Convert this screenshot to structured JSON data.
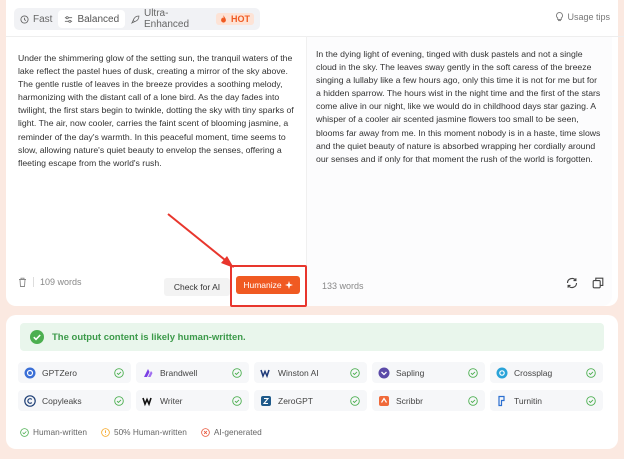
{
  "modes": [
    {
      "label": "Fast",
      "icon": "clock-icon",
      "active": false
    },
    {
      "label": "Balanced",
      "icon": "sliders-icon",
      "active": true
    },
    {
      "label": "Ultra-Enhanced",
      "icon": "rocket-icon",
      "active": false
    }
  ],
  "hot_badge": "HOT",
  "usage_tips": "Usage tips",
  "input": {
    "text": "Under the shimmering glow of the setting sun, the tranquil waters of the lake reflect the pastel hues of dusk, creating a mirror of the sky above. The gentle rustle of leaves in the breeze provides a soothing melody, harmonizing with the distant call of a lone bird. As the day fades into twilight, the first stars begin to twinkle, dotting the sky with tiny sparks of light. The air, now cooler, carries the faint scent of blooming jasmine, a reminder of the day's warmth. In this peaceful moment, time seems to slow, allowing nature's quiet beauty to envelop the senses, offering a fleeting escape from the world's rush.",
    "word_count": "109 words"
  },
  "output": {
    "text": "In the dying light of evening, tinged with dusk pastels and not a single cloud in the sky. The leaves sway gently in the soft caress of the breeze singing a lullaby like a few hours ago, only this time it is not for me but for a hidden sparrow. The hours wist in the night time and the first of the stars come alive in our night, like we would do in childhood days star gazing. A whisper of a cooler air scented jasmine flowers too small to be seen, blooms far away from me. In this moment nobody is in a haste, time slows and the quiet beauty of nature is absorbed wrapping her cordially around our senses and if only for that moment the rush of the world is forgotten.",
    "word_count": "133 words"
  },
  "buttons": {
    "check_ai": "Check for AI",
    "humanize": "Humanize"
  },
  "result": {
    "message": "The output content is likely human-written."
  },
  "detectors": [
    {
      "name": "GPTZero",
      "logo": "gptzero-logo-icon",
      "status": "human"
    },
    {
      "name": "Brandwell",
      "logo": "brandwell-logo-icon",
      "status": "human"
    },
    {
      "name": "Winston AI",
      "logo": "winston-logo-icon",
      "status": "human"
    },
    {
      "name": "Sapling",
      "logo": "sapling-logo-icon",
      "status": "human"
    },
    {
      "name": "Crossplag",
      "logo": "crossplag-logo-icon",
      "status": "human"
    },
    {
      "name": "Copyleaks",
      "logo": "copyleaks-logo-icon",
      "status": "human"
    },
    {
      "name": "Writer",
      "logo": "writer-logo-icon",
      "status": "human"
    },
    {
      "name": "ZeroGPT",
      "logo": "zerogpt-logo-icon",
      "status": "human"
    },
    {
      "name": "Scribbr",
      "logo": "scribbr-logo-icon",
      "status": "human"
    },
    {
      "name": "Turnitin",
      "logo": "turnitin-logo-icon",
      "status": "human"
    }
  ],
  "legend": [
    {
      "label": "Human-written",
      "color": "#4caf50"
    },
    {
      "label": "50% Human-written",
      "color": "#f5a623"
    },
    {
      "label": "AI-generated",
      "color": "#e8553a"
    }
  ],
  "colors": {
    "accent": "#f05a22",
    "success": "#4caf50",
    "highlight_frame": "#e8362d"
  }
}
